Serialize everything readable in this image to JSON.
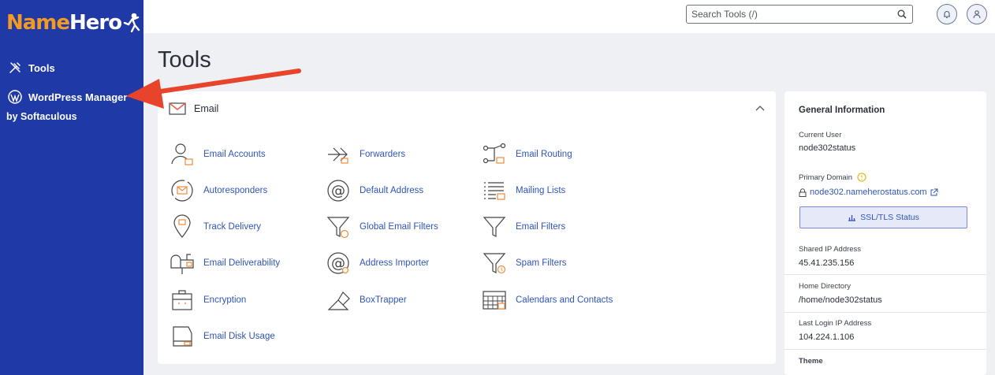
{
  "brand": {
    "name_part1": "Name",
    "name_part2": "Hero"
  },
  "sidebar": {
    "items": [
      {
        "label": "Tools",
        "icon": "tools-icon"
      },
      {
        "label": "WordPress Manager",
        "sub": "by Softaculous",
        "icon": "wordpress-icon"
      }
    ]
  },
  "topbar": {
    "search_placeholder": "Search Tools (/)"
  },
  "page": {
    "title": "Tools"
  },
  "email_section": {
    "title": "Email",
    "tools": [
      {
        "label": "Email Accounts",
        "icon": "email-accounts-icon"
      },
      {
        "label": "Forwarders",
        "icon": "forwarders-icon"
      },
      {
        "label": "Email Routing",
        "icon": "email-routing-icon"
      },
      {
        "label": "Autoresponders",
        "icon": "autoresponders-icon"
      },
      {
        "label": "Default Address",
        "icon": "default-address-icon"
      },
      {
        "label": "Mailing Lists",
        "icon": "mailing-lists-icon"
      },
      {
        "label": "Track Delivery",
        "icon": "track-delivery-icon"
      },
      {
        "label": "Global Email Filters",
        "icon": "global-filters-icon"
      },
      {
        "label": "Email Filters",
        "icon": "email-filters-icon"
      },
      {
        "label": "Email Deliverability",
        "icon": "deliverability-icon"
      },
      {
        "label": "Address Importer",
        "icon": "address-importer-icon"
      },
      {
        "label": "Spam Filters",
        "icon": "spam-filters-icon"
      },
      {
        "label": "Encryption",
        "icon": "encryption-icon"
      },
      {
        "label": "BoxTrapper",
        "icon": "boxtrapper-icon"
      },
      {
        "label": "Calendars and Contacts",
        "icon": "calendars-icon"
      },
      {
        "label": "Email Disk Usage",
        "icon": "disk-usage-icon"
      }
    ]
  },
  "general_info": {
    "title": "General Information",
    "current_user_label": "Current User",
    "current_user": "node302status",
    "primary_domain_label": "Primary Domain",
    "primary_domain": "node302.nameherostatus.com",
    "ssl_button": "SSL/TLS Status",
    "shared_ip_label": "Shared IP Address",
    "shared_ip": "45.41.235.156",
    "home_dir_label": "Home Directory",
    "home_dir": "/home/node302status",
    "last_login_label": "Last Login IP Address",
    "last_login": "104.224.1.106",
    "theme_label": "Theme"
  },
  "colors": {
    "sidebar": "#1f3aa6",
    "brand_orange": "#f49a22",
    "link_blue": "#2f55b8",
    "arrow_red": "#e8432b",
    "icon_orange": "#f08a3c"
  }
}
